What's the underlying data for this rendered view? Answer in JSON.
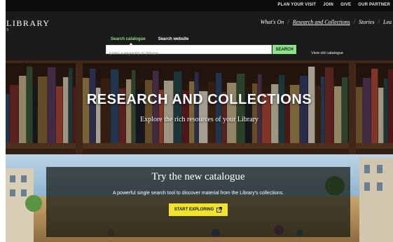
{
  "utility_nav": {
    "items": [
      "PLAN YOUR VISIT",
      "JOIN",
      "GIVE",
      "OUR PARTNER"
    ]
  },
  "header": {
    "logo_text": "LIBRARY",
    "logo_sub": "S",
    "nav": [
      {
        "label": "What's On",
        "active": false
      },
      {
        "label": "Research and Collections",
        "active": true
      },
      {
        "label": "Stories",
        "active": false
      },
      {
        "label": "Lea",
        "active": false
      }
    ]
  },
  "search": {
    "tabs": [
      {
        "label": "Search catalogue",
        "selected": true
      },
      {
        "label": "Search website",
        "selected": false
      }
    ],
    "placeholder": "Enter a keyword or phrase",
    "button_label": "SEARCH",
    "old_catalogue_link": "View old catalogue",
    "accent_color": "#8fe08a"
  },
  "hero": {
    "title": "RESEARCH AND COLLECTIONS",
    "subtitle": "Explore the rich resources of your Library"
  },
  "promo": {
    "title": "Try the new catalogue",
    "text": "A powerful single search tool to discover material from the Library's collections.",
    "button_label": "START EXPLORING",
    "button_icon": "external-link-icon",
    "button_color": "#f2e22a"
  }
}
